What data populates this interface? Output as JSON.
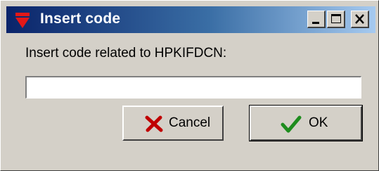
{
  "window": {
    "title": "Insert code",
    "icon": "red-arrow-icon",
    "controls": {
      "minimize": "minimize-icon",
      "maximize": "maximize-icon",
      "close": "close-icon"
    }
  },
  "form": {
    "label": "Insert code related to HPKIFDCN:",
    "code_value": "",
    "code_placeholder": ""
  },
  "buttons": {
    "cancel": {
      "label": "Cancel",
      "icon": "red-x-icon"
    },
    "ok": {
      "label": "OK",
      "icon": "green-check-icon"
    }
  },
  "colors": {
    "titlebar_start": "#0a246a",
    "titlebar_end": "#a6caf0",
    "dialog_face": "#d4d0c8",
    "cancel_icon": "#c00000",
    "ok_icon": "#1e8c1e",
    "app_icon": "#e21818"
  }
}
